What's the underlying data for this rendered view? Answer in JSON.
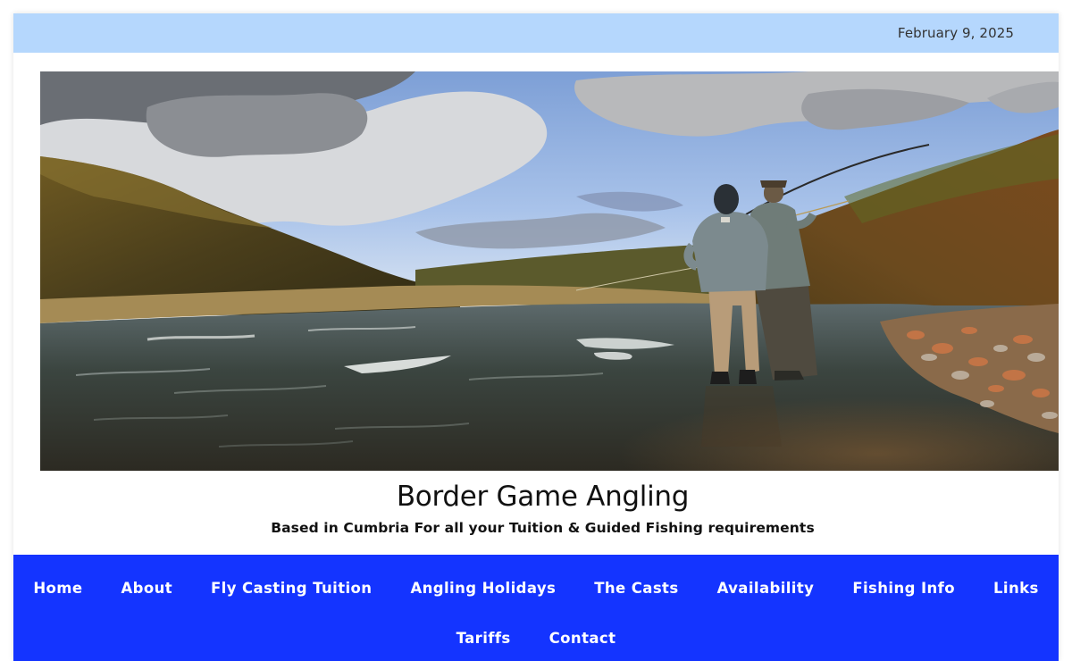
{
  "topbar": {
    "date": "February 9, 2025",
    "background": "#b5d7fd"
  },
  "hero": {
    "alt": "Two anglers fly fishing in a river between grassy hills"
  },
  "site": {
    "title": "Border Game Angling",
    "tagline": "Based in Cumbria For all your Tuition & Guided Fishing requirements"
  },
  "nav": {
    "background": "#1434ff",
    "items": [
      {
        "label": "Home"
      },
      {
        "label": "About"
      },
      {
        "label": "Fly Casting Tuition"
      },
      {
        "label": "Angling Holidays"
      },
      {
        "label": "The Casts"
      },
      {
        "label": "Availability"
      },
      {
        "label": "Fishing Info"
      },
      {
        "label": "Links"
      },
      {
        "label": "Tariffs"
      },
      {
        "label": "Contact"
      }
    ]
  }
}
